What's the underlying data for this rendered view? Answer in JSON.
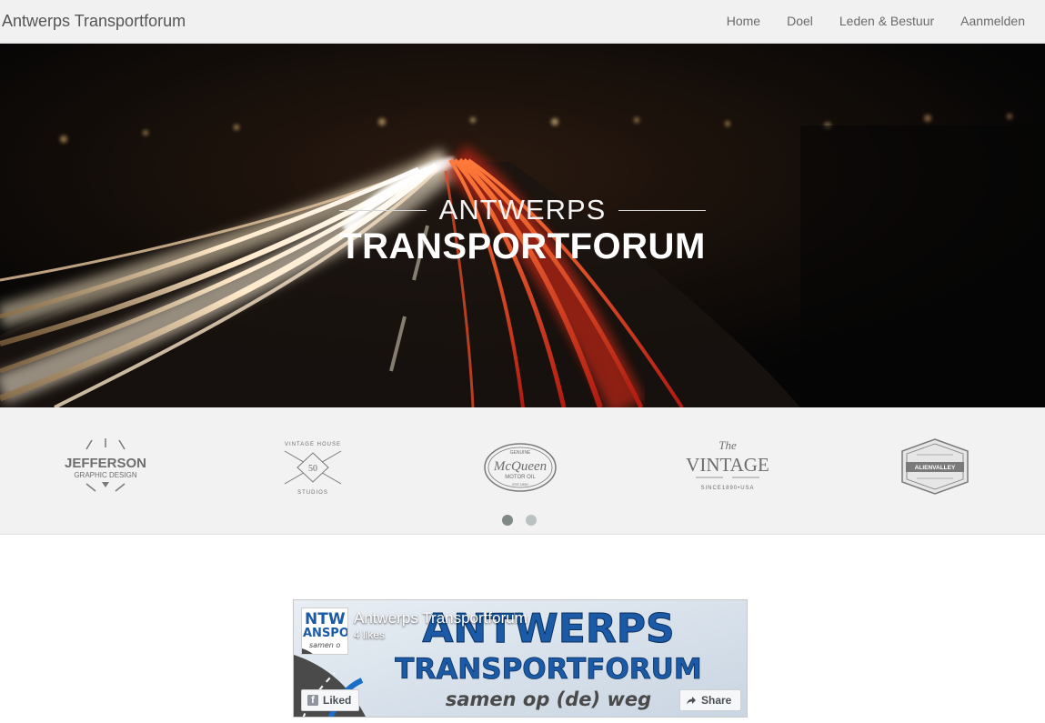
{
  "navbar": {
    "brand": "Antwerps Transportforum",
    "links": [
      "Home",
      "Doel",
      "Leden & Bestuur",
      "Aanmelden"
    ]
  },
  "hero": {
    "title_top": "ANTWERPS",
    "title_bottom": "TRANSPORTFORUM"
  },
  "logos": {
    "items": [
      {
        "name": "jefferson-logo",
        "line1": "JEFFERSON",
        "line2": "GRAPHIC DESIGN"
      },
      {
        "name": "vintage-house-logo",
        "line1": "VINTAGE HOUSE",
        "line2": "STUDIOS",
        "badge": "50"
      },
      {
        "name": "mcqueen-logo",
        "line1": "McQueen",
        "line2": "MOTOR OIL",
        "top": "GENUINE",
        "bottom": "EST.1950"
      },
      {
        "name": "the-vintage-logo",
        "line1": "The",
        "line2": "VINTAGE",
        "line3": "SINCE1890•USA"
      },
      {
        "name": "alienvalley-logo",
        "line1": "ALIENVALLEY"
      }
    ],
    "carousel_pages": 2,
    "active_page": 1
  },
  "facebook": {
    "page_name": "Antwerps Transportforum",
    "likes": "4 likes",
    "liked_label": "Liked",
    "share_label": "Share",
    "cover_line1": "ANTWERPS",
    "cover_line2": "TRANSPORTFORUM",
    "cover_line3": "samen op (de) weg",
    "avatar_text1": "NTW",
    "avatar_text2": "ANSPO",
    "avatar_text3": "samen o"
  },
  "colors": {
    "navbar_bg": "#f1f1f1",
    "logos_bg": "#f2f2f2",
    "fb_blue": "#1a5aa6",
    "light_trail_red": "#d0301c"
  }
}
